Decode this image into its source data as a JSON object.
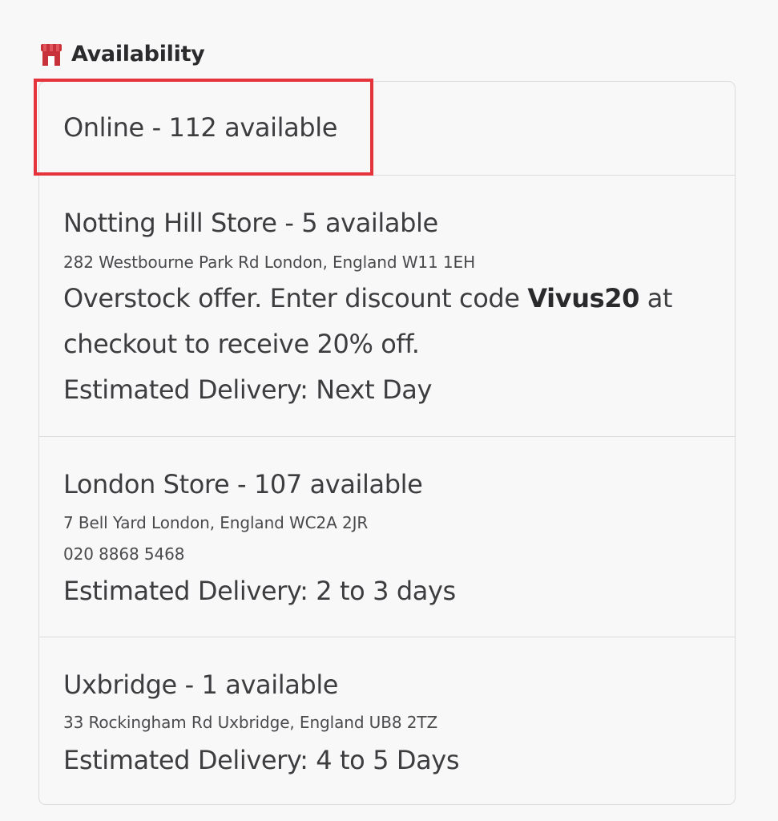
{
  "header": {
    "title": "Availability",
    "icon": "store-icon",
    "icon_color": "#c8323a"
  },
  "online": {
    "label": "Online - 112 available",
    "highlight_color": "#e5333c"
  },
  "stores": [
    {
      "name": "Notting Hill Store - 5 available",
      "address": "282 Westbourne Park Rd London, England W11 1EH",
      "offer_prefix": "Overstock offer. Enter discount code ",
      "offer_code": "Vivus20",
      "offer_suffix": " at",
      "offer_line2": "checkout to receive 20% off.",
      "delivery": "Estimated Delivery: Next Day"
    },
    {
      "name": "London Store - 107 available",
      "address": "7 Bell Yard London, England WC2A 2JR",
      "phone": "020 8868 5468",
      "delivery": "Estimated Delivery: 2 to 3 days"
    },
    {
      "name": "Uxbridge - 1 available",
      "address": "33 Rockingham Rd Uxbridge, England UB8 2TZ",
      "delivery": "Estimated Delivery: 4 to 5 Days"
    }
  ]
}
